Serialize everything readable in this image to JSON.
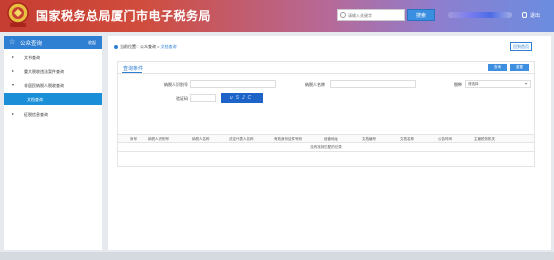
{
  "header": {
    "site_title": "国家税务总局厦门市电子税务局",
    "search_placeholder": "请输入关键字",
    "search_button": "搜索",
    "logout_label": "退出",
    "brand_color": "#c63d31"
  },
  "sidebar": {
    "title": "公众查询",
    "count_label": "收起",
    "items": [
      {
        "label": "文书查询",
        "caret": "▸"
      },
      {
        "label": "重大税收违法案件查询",
        "caret": "▸"
      },
      {
        "label": "非居民纳税人税收查询",
        "caret": "▾"
      },
      {
        "label": "文档查询",
        "caret": ""
      },
      {
        "label": "征税信息查询",
        "caret": "▸"
      }
    ]
  },
  "breadcrumb": {
    "prefix": "当前位置：",
    "section": "公众查询",
    "separator": " > ",
    "current": "文档查询"
  },
  "home_button": "回到首页",
  "query_panel": {
    "title": "查询条件",
    "query_button": "查询",
    "reset_button": "重置",
    "fields": {
      "taxpayer_id_label": "纳税人识别号",
      "taxpayer_name_label": "纳税人名称",
      "tax_type_label": "税种",
      "tax_type_value": "请选择",
      "captcha_label": "验证码",
      "captcha_text": "uSJC"
    }
  },
  "table": {
    "columns": [
      "序号",
      "纳税人识别号",
      "纳税人名称",
      "法定代表人名称",
      "有效身份证件号码",
      "经营地址",
      "文档编号",
      "文档名称",
      "公告时间",
      "主管税务机关"
    ],
    "empty_text": "没有找到匹配的记录"
  }
}
